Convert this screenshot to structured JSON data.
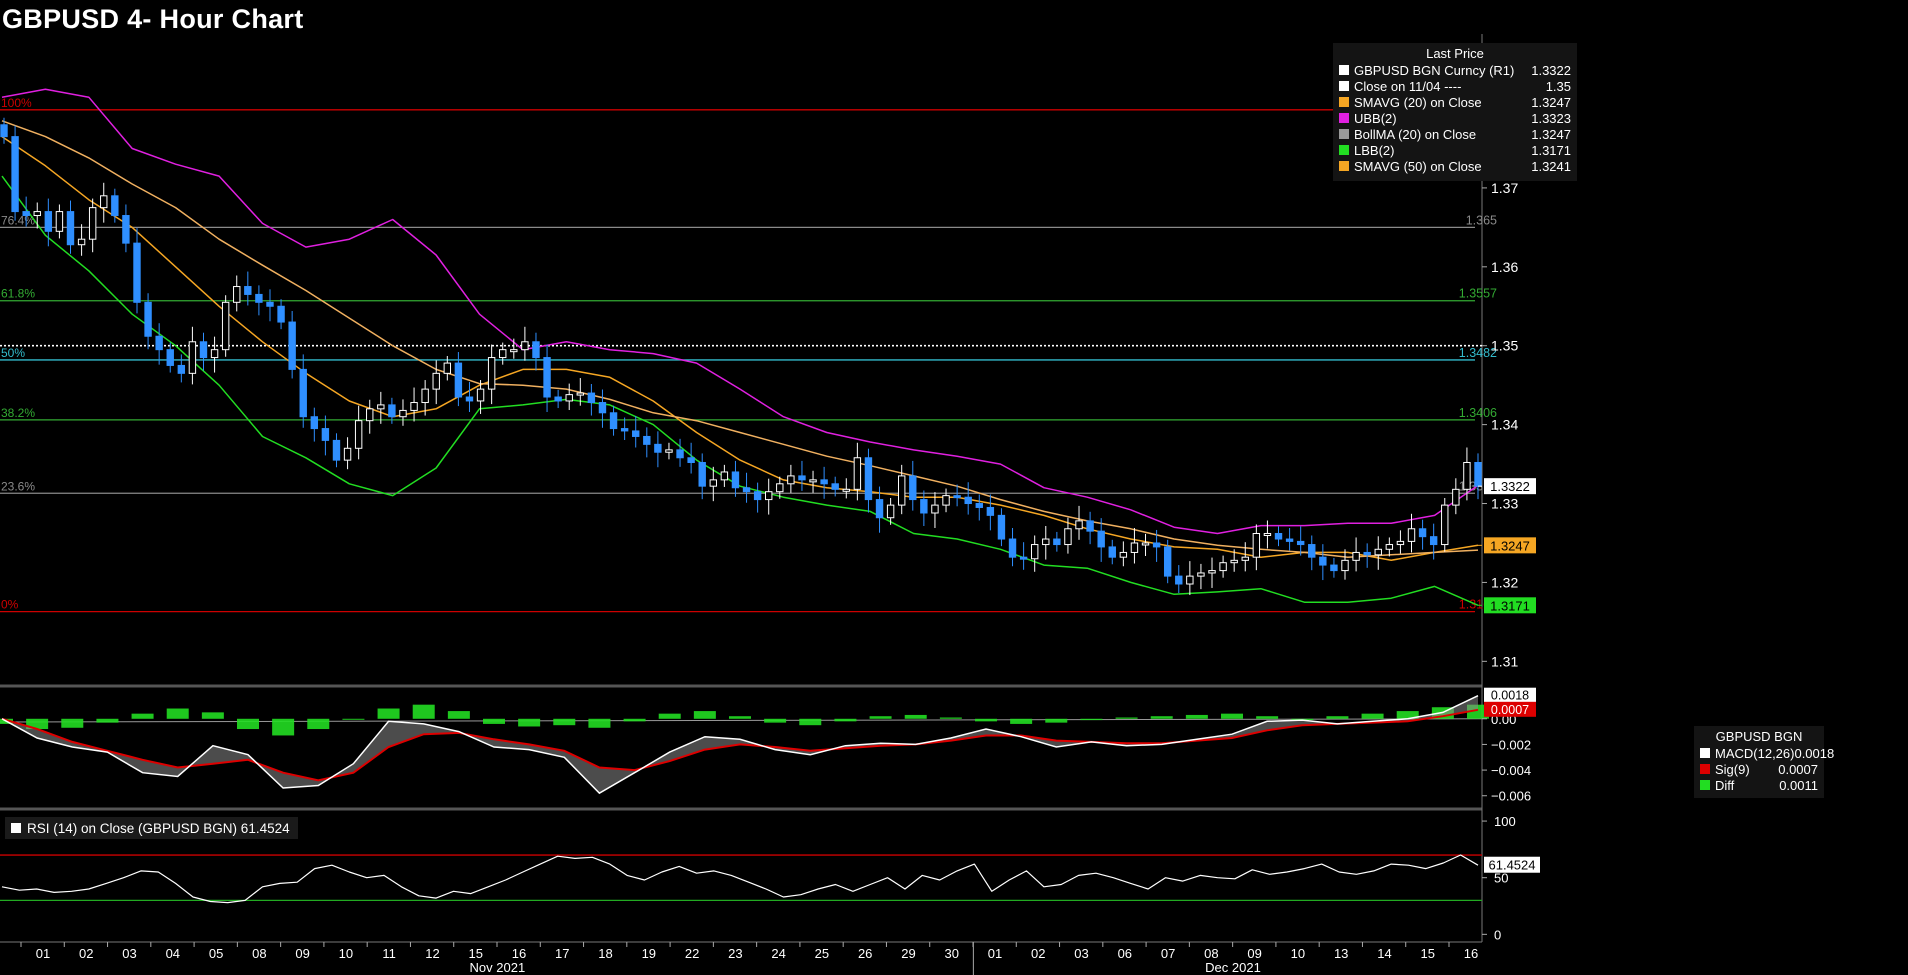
{
  "page": {
    "title": "GBPUSD 4- Hour Chart"
  },
  "colors": {
    "background": "#000000",
    "candle_up": "#ffffff",
    "candle_down": "#2f8fff",
    "sma20": "#f5a623",
    "sma50": "#f0b060",
    "ubb": "#e020e0",
    "lbb": "#22dd22",
    "macd": "#ffffff",
    "signal": "#dd0000",
    "diff": "#22dd22",
    "fib_100": "#cc0000",
    "fib_0": "#cc0000",
    "fib_grey": "#8a8a8a",
    "fib_green": "#33aa33",
    "fib_cyan": "#33bbcc"
  },
  "legend": {
    "title": "Last Price",
    "items": [
      {
        "label": "GBPUSD BGN Curncy  (R1)",
        "value": "1.3322",
        "color": "#ffffff"
      },
      {
        "label": "Close on 11/04 ----",
        "value": "1.35",
        "color": "#ffffff"
      },
      {
        "label": "SMAVG (20)  on Close",
        "value": "1.3247",
        "color": "#f5a623"
      },
      {
        "label": "UBB(2)",
        "value": "1.3323",
        "color": "#e020e0"
      },
      {
        "label": "BollMA (20)  on Close",
        "value": "1.3247",
        "color": "#9a9a9a"
      },
      {
        "label": "LBB(2)",
        "value": "1.3171",
        "color": "#22dd22"
      },
      {
        "label": "SMAVG (50)  on Close",
        "value": "1.3241",
        "color": "#f5a623"
      }
    ]
  },
  "macd_legend": {
    "title": "GBPUSD BGN",
    "items": [
      {
        "label": "MACD(12,26)",
        "value": "0.0018",
        "color": "#ffffff"
      },
      {
        "label": "Sig(9)",
        "value": "0.0007",
        "color": "#dd0000"
      },
      {
        "label": "Diff",
        "value": "0.0011",
        "color": "#22dd22"
      }
    ]
  },
  "rsi_legend": {
    "label": "RSI (14)  on Close (GBPUSD BGN) 61.4524"
  },
  "chart_data": [
    {
      "type": "candlestick",
      "title": "GBPUSD 4- Hour Chart",
      "x_axis": {
        "days": [
          "01",
          "02",
          "03",
          "04",
          "05",
          "08",
          "09",
          "10",
          "11",
          "12",
          "15",
          "16",
          "17",
          "18",
          "19",
          "22",
          "23",
          "24",
          "25",
          "26",
          "29",
          "30",
          "01",
          "02",
          "03",
          "06",
          "07",
          "08",
          "09",
          "10",
          "13",
          "14",
          "15",
          "16"
        ],
        "months": [
          {
            "label": "Nov 2021",
            "from_day_index": 0,
            "to_day_index": 21
          },
          {
            "label": "Dec 2021",
            "from_day_index": 22,
            "to_day_index": 33
          }
        ]
      },
      "y_axis": {
        "range": [
          1.307,
          1.389
        ],
        "ticks": [
          "1.31",
          "1.32",
          "1.33",
          "1.34",
          "1.35",
          "1.36",
          "1.37",
          "1.38"
        ]
      },
      "fibonacci_levels": [
        {
          "label": "100%",
          "value": 1.3799,
          "value_label": "1.3799",
          "color": "#cc0000"
        },
        {
          "label": "76.4%",
          "value": 1.365,
          "value_label": "1.365",
          "color": "#8a8a8a"
        },
        {
          "label": "61.8%",
          "value": 1.3557,
          "value_label": "1.3557",
          "color": "#33aa33"
        },
        {
          "label": "50%",
          "value": 1.3482,
          "value_label": "1.3482",
          "color": "#33bbcc"
        },
        {
          "label": "38.2%",
          "value": 1.3406,
          "value_label": "1.3406",
          "color": "#33aa33"
        },
        {
          "label": "23.6%",
          "value": 1.3313,
          "value_label": "1.3313",
          "color": "#8a8a8a"
        },
        {
          "label": "0%",
          "value": 1.3163,
          "value_label": "1.3163",
          "color": "#cc0000"
        }
      ],
      "reference_line": {
        "label": "Close on 11/04",
        "value": 1.35
      },
      "price_tags": [
        {
          "value": 1.3322,
          "label": "1.3322",
          "bg": "#ffffff",
          "fg": "#000000"
        },
        {
          "value": 1.3247,
          "label": "1.3247",
          "bg": "#f5a623",
          "fg": "#000000"
        },
        {
          "value": 1.3171,
          "label": "1.3171",
          "bg": "#22dd22",
          "fg": "#000000"
        }
      ],
      "series": [
        {
          "name": "GBPUSD BGN Curncy",
          "kind": "close",
          "values": [
            1.3765,
            1.367,
            1.3665,
            1.367,
            1.3645,
            1.367,
            1.3628,
            1.3635,
            1.3675,
            1.369,
            1.3665,
            1.363,
            1.3555,
            1.3512,
            1.3495,
            1.3475,
            1.3465,
            1.3505,
            1.3485,
            1.3495,
            1.3555,
            1.3575,
            1.3565,
            1.3555,
            1.355,
            1.353,
            1.347,
            1.341,
            1.3395,
            1.338,
            1.3355,
            1.337,
            1.3405,
            1.342,
            1.3425,
            1.341,
            1.3418,
            1.3428,
            1.3445,
            1.3465,
            1.3478,
            1.3435,
            1.343,
            1.3445,
            1.3485,
            1.3495,
            1.3495,
            1.3505,
            1.3485,
            1.3435,
            1.343,
            1.3438,
            1.344,
            1.3428,
            1.3415,
            1.3395,
            1.3392,
            1.3385,
            1.3375,
            1.3365,
            1.3368,
            1.3358,
            1.3352,
            1.3322,
            1.333,
            1.334,
            1.332,
            1.3315,
            1.3305,
            1.3315,
            1.3325,
            1.3335,
            1.333,
            1.333,
            1.3325,
            1.3318,
            1.3318,
            1.3358,
            1.3305,
            1.3282,
            1.3298,
            1.3335,
            1.3305,
            1.3288,
            1.3298,
            1.331,
            1.3308,
            1.33,
            1.3295,
            1.3285,
            1.3255,
            1.3232,
            1.323,
            1.3248,
            1.3255,
            1.3248,
            1.3268,
            1.3278,
            1.3265,
            1.3245,
            1.3232,
            1.3238,
            1.325,
            1.325,
            1.3245,
            1.3208,
            1.3198,
            1.3208,
            1.3212,
            1.3215,
            1.3225,
            1.3228,
            1.3232,
            1.3262,
            1.3262,
            1.3255,
            1.3252,
            1.3248,
            1.3232,
            1.3222,
            1.3215,
            1.3228,
            1.3238,
            1.3235,
            1.3242,
            1.3248,
            1.3252,
            1.3268,
            1.3258,
            1.3248,
            1.3298,
            1.3318,
            1.3352,
            1.3322
          ]
        },
        {
          "name": "SMAVG (20)",
          "kind": "line",
          "x_start": 0,
          "x_end": 1,
          "color": "#f5a623",
          "values": [
            1.3765,
            1.3728,
            1.3685,
            1.365,
            1.36,
            1.355,
            1.3505,
            1.3465,
            1.343,
            1.341,
            1.342,
            1.345,
            1.347,
            1.347,
            1.346,
            1.343,
            1.339,
            1.3355,
            1.333,
            1.332,
            1.3315,
            1.3308,
            1.3308,
            1.3298,
            1.3285,
            1.3268,
            1.3255,
            1.3245,
            1.3242,
            1.3232,
            1.3238,
            1.3238,
            1.3228,
            1.3238,
            1.3247
          ]
        },
        {
          "name": "SMAVG (50)",
          "kind": "line",
          "x_start": 0,
          "x_end": 1,
          "color": "#f0b060",
          "values": [
            1.3785,
            1.3765,
            1.3738,
            1.3705,
            1.3675,
            1.3635,
            1.3602,
            1.357,
            1.3535,
            1.35,
            1.347,
            1.3452,
            1.345,
            1.3445,
            1.3432,
            1.3415,
            1.3405,
            1.339,
            1.3375,
            1.336,
            1.3348,
            1.3335,
            1.3322,
            1.3305,
            1.329,
            1.3278,
            1.3268,
            1.3255,
            1.3247,
            1.3242,
            1.3238,
            1.3232,
            1.3235,
            1.3238,
            1.3241
          ]
        },
        {
          "name": "UBB(2)",
          "kind": "line",
          "x_start": 0,
          "x_end": 1,
          "color": "#e020e0",
          "values": [
            1.3815,
            1.3825,
            1.3815,
            1.375,
            1.373,
            1.3715,
            1.3655,
            1.3625,
            1.3635,
            1.366,
            1.3615,
            1.354,
            1.3495,
            1.3505,
            1.3495,
            1.349,
            1.3478,
            1.3445,
            1.341,
            1.339,
            1.3378,
            1.3368,
            1.336,
            1.335,
            1.332,
            1.3308,
            1.3292,
            1.327,
            1.3262,
            1.3272,
            1.3272,
            1.3275,
            1.3275,
            1.3285,
            1.3323
          ]
        },
        {
          "name": "LBB(2)",
          "kind": "line",
          "x_start": 0,
          "x_end": 1,
          "color": "#22dd22",
          "values": [
            1.3715,
            1.364,
            1.3595,
            1.354,
            1.35,
            1.345,
            1.3385,
            1.3358,
            1.3325,
            1.331,
            1.3345,
            1.342,
            1.3425,
            1.3432,
            1.3425,
            1.34,
            1.3355,
            1.3322,
            1.3308,
            1.3298,
            1.329,
            1.3262,
            1.3255,
            1.3242,
            1.3222,
            1.3218,
            1.32,
            1.3185,
            1.3188,
            1.3192,
            1.3175,
            1.3175,
            1.318,
            1.3195,
            1.3171
          ]
        }
      ]
    },
    {
      "type": "line",
      "title": "MACD",
      "y_axis": {
        "range": [
          -0.0068,
          0.0024
        ],
        "ticks": [
          "0.00",
          "−0.002",
          "−0.004",
          "−0.006"
        ]
      },
      "value_tags": [
        {
          "value": 0.0018,
          "label": "0.0018",
          "bg": "#ffffff",
          "fg": "#000000"
        },
        {
          "value": 0.0007,
          "label": "0.0007",
          "bg": "#dd0000",
          "fg": "#ffffff"
        }
      ],
      "series": [
        {
          "name": "MACD(12,26)",
          "color": "#ffffff",
          "x_start": 0,
          "x_end": 1,
          "values": [
            0.0,
            -0.0015,
            -0.0022,
            -0.0026,
            -0.0042,
            -0.0045,
            -0.0021,
            -0.0028,
            -0.0054,
            -0.0052,
            -0.0035,
            -0.0002,
            -0.0004,
            -0.001,
            -0.0022,
            -0.0024,
            -0.003,
            -0.0058,
            -0.0042,
            -0.0026,
            -0.0014,
            -0.0016,
            -0.0024,
            -0.0028,
            -0.0021,
            -0.0019,
            -0.002,
            -0.0015,
            -0.0008,
            -0.0014,
            -0.0022,
            -0.0018,
            -0.0021,
            -0.002,
            -0.0016,
            -0.0012,
            -0.0002,
            -0.0001,
            -0.0004,
            -0.0002,
            0.0,
            0.0005,
            0.0018
          ]
        },
        {
          "name": "Sig(9)",
          "color": "#dd0000",
          "x_start": 0,
          "x_end": 1,
          "values": [
            0.0,
            -0.0008,
            -0.0018,
            -0.0025,
            -0.0032,
            -0.0038,
            -0.0035,
            -0.0032,
            -0.0042,
            -0.0048,
            -0.0042,
            -0.0022,
            -0.0012,
            -0.0011,
            -0.0016,
            -0.002,
            -0.0025,
            -0.0038,
            -0.004,
            -0.0033,
            -0.0024,
            -0.002,
            -0.0022,
            -0.0025,
            -0.0023,
            -0.0021,
            -0.002,
            -0.0017,
            -0.0013,
            -0.0013,
            -0.0017,
            -0.0018,
            -0.0019,
            -0.0019,
            -0.0017,
            -0.0015,
            -0.0009,
            -0.0005,
            -0.0004,
            -0.0003,
            -0.0002,
            0.0002,
            0.0007
          ]
        },
        {
          "name": "Diff",
          "kind": "histogram",
          "color": "#22dd22",
          "x_start": 0,
          "x_end": 1,
          "values": [
            -0.0004,
            -0.0008,
            -0.0007,
            -0.0003,
            0.0004,
            0.0008,
            0.0005,
            -0.0008,
            -0.0013,
            -0.0008,
            0.0,
            0.0008,
            0.0011,
            0.0006,
            -0.0004,
            -0.0006,
            -0.0005,
            -0.0007,
            -0.0002,
            0.0004,
            0.0006,
            0.0002,
            -0.0003,
            -0.0005,
            -0.0002,
            0.0002,
            0.0003,
            0.0001,
            -0.0002,
            -0.0004,
            -0.0003,
            -0.0001,
            0.0001,
            0.0002,
            0.0003,
            0.0004,
            0.0002,
            -0.0001,
            0.0002,
            0.0004,
            0.0006,
            0.0009,
            0.0011
          ]
        }
      ]
    },
    {
      "type": "line",
      "title": "RSI (14)",
      "y_axis": {
        "range": [
          -5,
          108
        ],
        "ticks": [
          "100",
          "50",
          "0"
        ]
      },
      "reference_lines": [
        {
          "value": 70,
          "color": "#cc0000"
        },
        {
          "value": 30,
          "color": "#22aa22"
        }
      ],
      "value_tags": [
        {
          "value": 61.4524,
          "label": "61.4524",
          "bg": "#ffffff",
          "fg": "#000000"
        }
      ],
      "series": [
        {
          "name": "RSI (14)",
          "color": "#ffffff",
          "x_start": 0,
          "x_end": 1,
          "values": [
            42,
            39,
            40,
            37,
            38,
            40,
            45,
            50,
            56,
            55,
            45,
            33,
            29,
            28,
            30,
            42,
            45,
            46,
            58,
            61,
            55,
            50,
            52,
            42,
            34,
            32,
            38,
            36,
            42,
            48,
            55,
            62,
            69,
            67,
            68,
            62,
            52,
            48,
            55,
            60,
            54,
            56,
            52,
            46,
            40,
            33,
            35,
            40,
            44,
            38,
            44,
            50,
            40,
            52,
            48,
            56,
            62,
            38,
            48,
            56,
            42,
            44,
            52,
            54,
            50,
            45,
            40,
            50,
            47,
            52,
            50,
            49,
            57,
            53,
            55,
            58,
            62,
            55,
            53,
            56,
            62,
            61,
            58,
            63,
            70,
            61
          ]
        }
      ]
    }
  ]
}
